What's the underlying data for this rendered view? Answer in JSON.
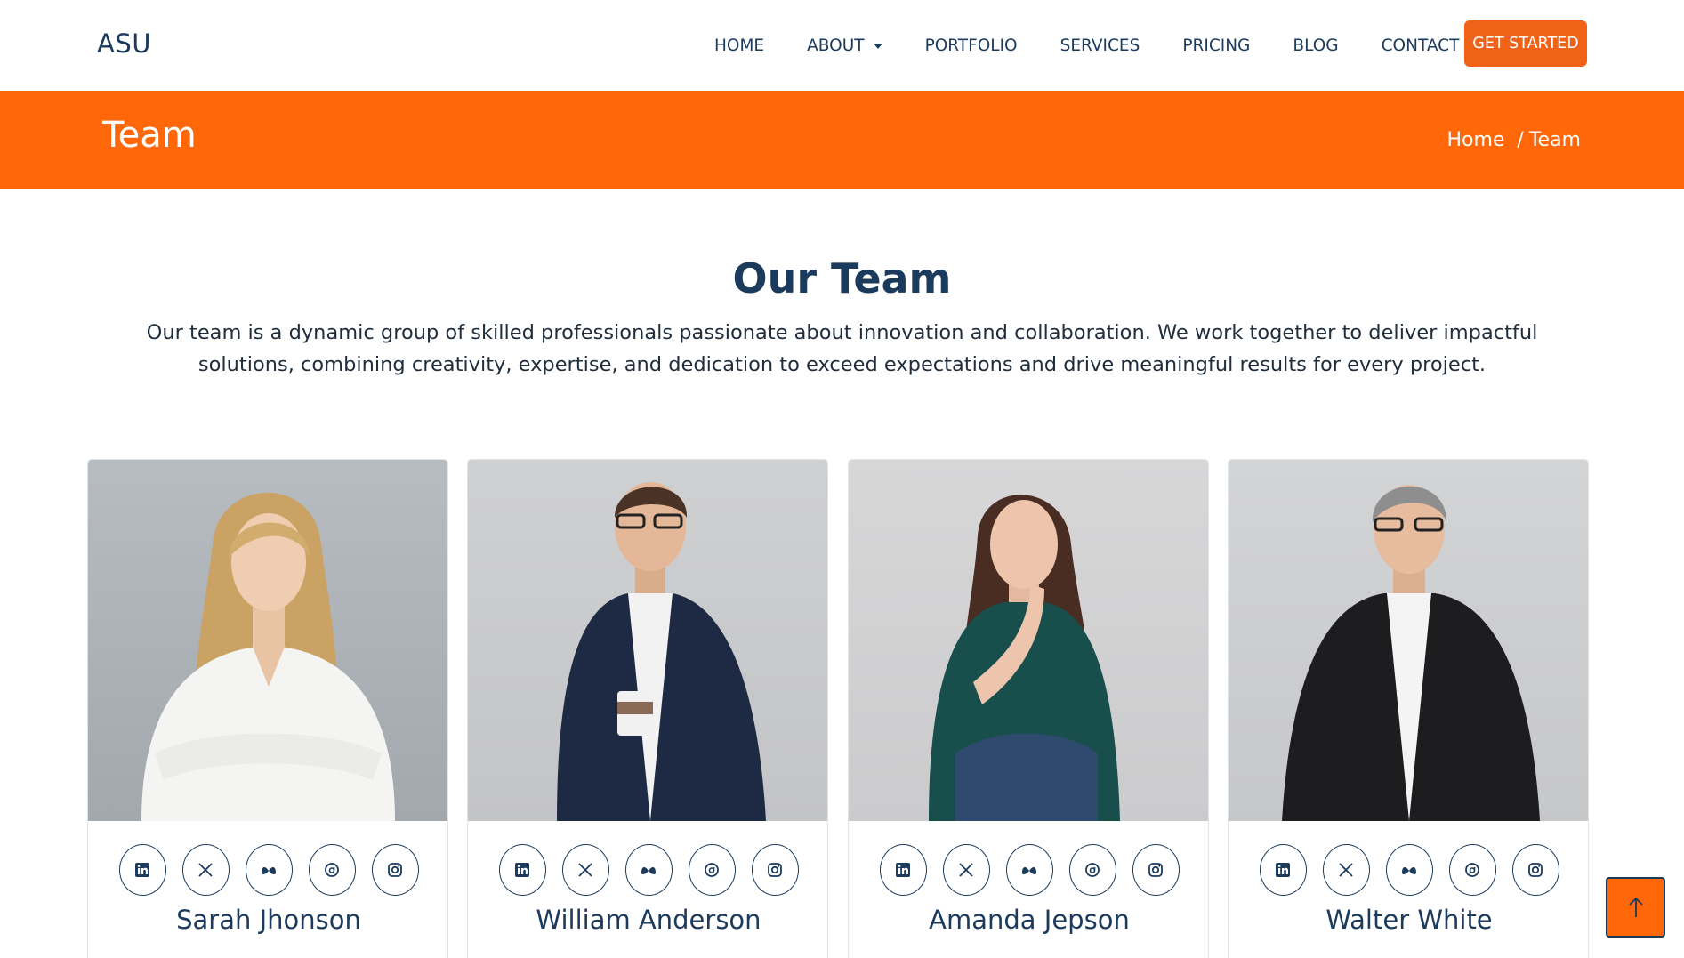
{
  "brand": "ASU",
  "nav": {
    "items": [
      {
        "label": "HOME"
      },
      {
        "label": "ABOUT",
        "dropdown": true
      },
      {
        "label": "PORTFOLIO"
      },
      {
        "label": "SERVICES"
      },
      {
        "label": "PRICING"
      },
      {
        "label": "BLOG"
      },
      {
        "label": "CONTACT"
      }
    ],
    "cta_label": "GET STARTED"
  },
  "banner": {
    "title": "Team",
    "breadcrumb": [
      "Home",
      "Team"
    ],
    "separator": "/"
  },
  "section": {
    "title": "Our Team",
    "description": "Our team is a dynamic group of skilled professionals passionate about innovation and collaboration. We work together to deliver impactful solutions, combining creativity, expertise, and dedication to exceed expectations and drive meaningful results for every project."
  },
  "team": [
    {
      "name": "Sarah Jhonson"
    },
    {
      "name": "William Anderson"
    },
    {
      "name": "Amanda Jepson"
    },
    {
      "name": "Walter White"
    }
  ],
  "social_icons": [
    "linkedin-icon",
    "x-icon",
    "meta-icon",
    "threads-icon",
    "instagram-icon"
  ],
  "colors": {
    "accent": "#ff6708",
    "cta": "#f06218",
    "primary_text": "#1b3a5c"
  },
  "back_to_top_icon": "arrow-up-icon"
}
